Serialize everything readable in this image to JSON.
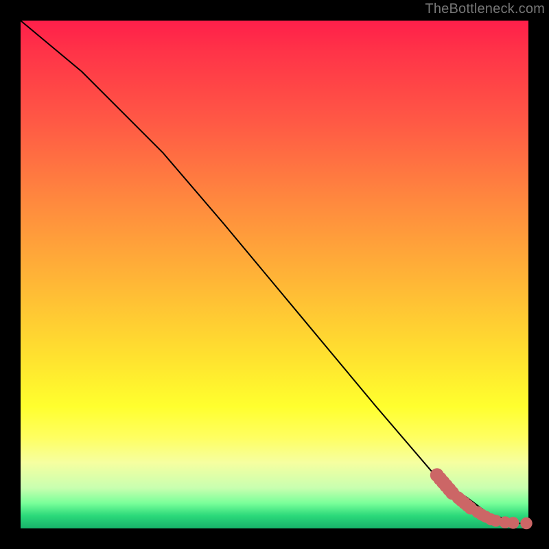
{
  "watermark": "TheBottleneck.com",
  "colors": {
    "frame": "#000000",
    "curve": "#000000",
    "marker": "#cc6666"
  },
  "chart_data": {
    "type": "line",
    "title": "",
    "xlabel": "",
    "ylabel": "",
    "xlim": [
      0,
      100
    ],
    "ylim": [
      0,
      100
    ],
    "grid": false,
    "legend": false,
    "annotations": [],
    "series": [
      {
        "name": "curve",
        "x": [
          0,
          12,
          20,
          28,
          40,
          55,
          70,
          82,
          88,
          92,
          95,
          97,
          100
        ],
        "y": [
          100,
          90,
          82,
          74,
          60,
          42,
          24,
          10,
          6,
          3,
          2,
          1,
          1
        ]
      }
    ],
    "markers": [
      {
        "x": 82.0,
        "y": 10.5,
        "r": 1.2
      },
      {
        "x": 82.6,
        "y": 9.8,
        "r": 1.2
      },
      {
        "x": 83.2,
        "y": 9.1,
        "r": 1.2
      },
      {
        "x": 83.8,
        "y": 8.4,
        "r": 1.2
      },
      {
        "x": 84.4,
        "y": 7.7,
        "r": 1.2
      },
      {
        "x": 85.0,
        "y": 7.0,
        "r": 1.2
      },
      {
        "x": 86.2,
        "y": 6.0,
        "r": 1.1
      },
      {
        "x": 86.8,
        "y": 5.5,
        "r": 1.1
      },
      {
        "x": 87.4,
        "y": 5.0,
        "r": 1.1
      },
      {
        "x": 88.0,
        "y": 4.5,
        "r": 1.1
      },
      {
        "x": 88.6,
        "y": 4.0,
        "r": 1.1
      },
      {
        "x": 90.0,
        "y": 3.2,
        "r": 1.0
      },
      {
        "x": 90.8,
        "y": 2.7,
        "r": 1.0
      },
      {
        "x": 91.6,
        "y": 2.3,
        "r": 1.0
      },
      {
        "x": 92.6,
        "y": 1.8,
        "r": 1.0
      },
      {
        "x": 93.6,
        "y": 1.5,
        "r": 1.0
      },
      {
        "x": 95.4,
        "y": 1.2,
        "r": 1.0
      },
      {
        "x": 97.0,
        "y": 1.1,
        "r": 1.0
      },
      {
        "x": 99.6,
        "y": 1.0,
        "r": 1.0
      }
    ]
  }
}
